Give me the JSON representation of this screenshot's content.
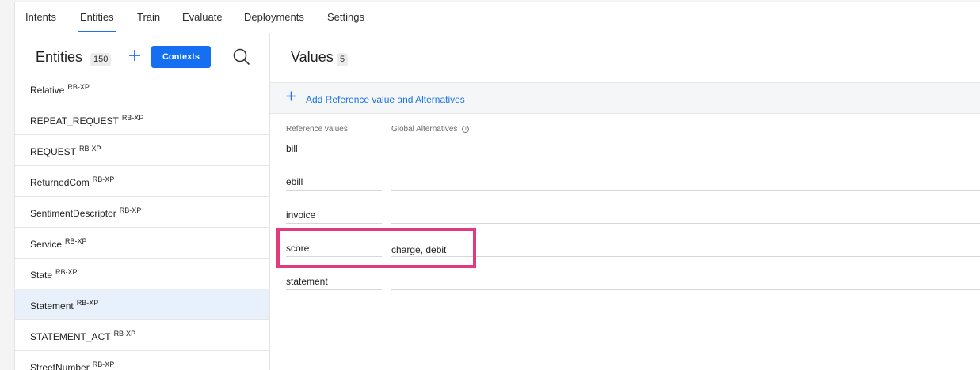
{
  "nav": {
    "tabs": [
      {
        "label": "Intents"
      },
      {
        "label": "Entities"
      },
      {
        "label": "Train"
      },
      {
        "label": "Evaluate"
      },
      {
        "label": "Deployments"
      },
      {
        "label": "Settings"
      }
    ],
    "active_tab": "Entities"
  },
  "entities_panel": {
    "title": "Entities",
    "count": "150",
    "add_icon": "plus-icon",
    "contexts_label": "Contexts",
    "search_icon": "search-icon",
    "items": [
      {
        "name": "Relative",
        "tag": "RB-XP"
      },
      {
        "name": "REPEAT_REQUEST",
        "tag": "RB-XP"
      },
      {
        "name": "REQUEST",
        "tag": "RB-XP"
      },
      {
        "name": "ReturnedCom",
        "tag": "RB-XP"
      },
      {
        "name": "SentimentDescriptor",
        "tag": "RB-XP"
      },
      {
        "name": "Service",
        "tag": "RB-XP"
      },
      {
        "name": "State",
        "tag": "RB-XP"
      },
      {
        "name": "Statement",
        "tag": "RB-XP"
      },
      {
        "name": "STATEMENT_ACT",
        "tag": "RB-XP"
      },
      {
        "name": "StreetNumber",
        "tag": "RB-XP"
      }
    ],
    "selected": "Statement"
  },
  "values_panel": {
    "title": "Values",
    "count": "5",
    "add_label": "Add Reference value and Alternatives",
    "col_reference": "Reference values",
    "col_alternatives": "Global Alternatives",
    "info_icon": "info-icon",
    "rows": [
      {
        "reference": "bill",
        "alternatives": ""
      },
      {
        "reference": "ebill",
        "alternatives": ""
      },
      {
        "reference": "invoice",
        "alternatives": ""
      },
      {
        "reference": "score",
        "alternatives": "charge, debit"
      },
      {
        "reference": "statement",
        "alternatives": ""
      }
    ]
  },
  "colors": {
    "accent": "#1a73e8",
    "button": "#1470f0",
    "highlight": "#e23b7d",
    "selected_row": "#e8f0fb"
  }
}
